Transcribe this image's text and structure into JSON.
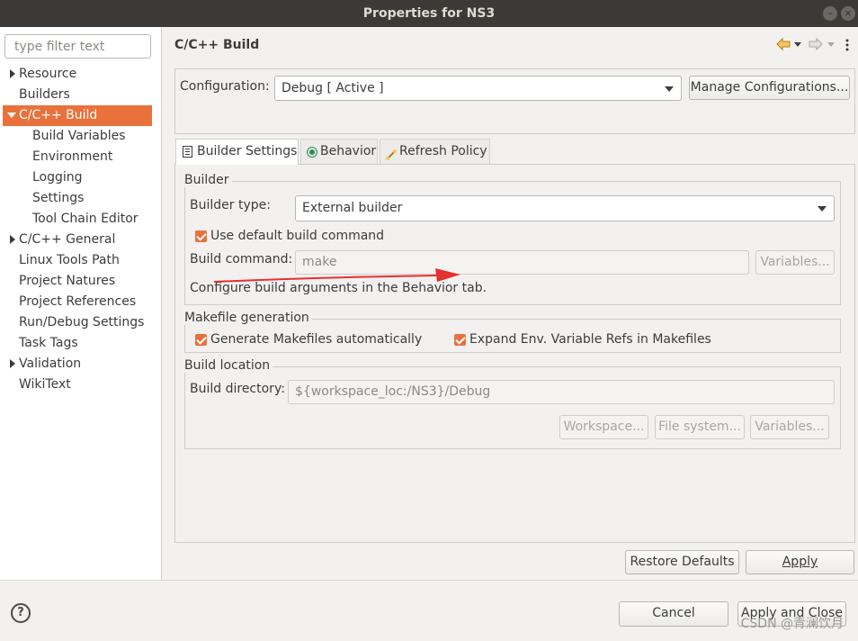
{
  "window": {
    "title": "Properties for NS3",
    "minimize_glyph": "–",
    "close_glyph": "×"
  },
  "sidebar": {
    "filter_placeholder": "type filter text",
    "items": [
      {
        "label": "Resource",
        "twisty": "collapsed"
      },
      {
        "label": "Builders"
      },
      {
        "label": "C/C++ Build",
        "twisty": "expanded",
        "selected": true
      },
      {
        "label": "Build Variables"
      },
      {
        "label": "Environment"
      },
      {
        "label": "Logging"
      },
      {
        "label": "Settings"
      },
      {
        "label": "Tool Chain Editor"
      },
      {
        "label": "C/C++ General",
        "twisty": "collapsed"
      },
      {
        "label": "Linux Tools Path"
      },
      {
        "label": "Project Natures"
      },
      {
        "label": "Project References"
      },
      {
        "label": "Run/Debug Settings"
      },
      {
        "label": "Task Tags"
      },
      {
        "label": "Validation",
        "twisty": "collapsed"
      },
      {
        "label": "WikiText"
      }
    ]
  },
  "header": {
    "title": "C/C++ Build",
    "back_icon": "back-arrow-icon",
    "forward_icon": "forward-arrow-icon",
    "menu_icon": "view-menu-icon"
  },
  "configuration": {
    "label": "Configuration:",
    "value": "Debug  [ Active ]",
    "manage_button": "Manage Configurations..."
  },
  "tabs": [
    {
      "label": "Builder Settings",
      "icon": "settings-sheet-icon",
      "active": true
    },
    {
      "label": "Behavior",
      "icon": "radio-icon"
    },
    {
      "label": "Refresh Policy",
      "icon": "refresh-policy-icon"
    }
  ],
  "builder": {
    "group_title": "Builder",
    "type_label": "Builder type:",
    "type_value": "External builder",
    "use_default_label": "Use default build command",
    "use_default_checked": true,
    "command_label": "Build command:",
    "command_value": "make",
    "variables_button": "Variables...",
    "hint": "Configure build arguments in the Behavior tab."
  },
  "makefile": {
    "group_title": "Makefile generation",
    "generate_label": "Generate Makefiles automatically",
    "generate_checked": true,
    "expand_label": "Expand Env. Variable Refs in Makefiles",
    "expand_checked": true
  },
  "location": {
    "group_title": "Build location",
    "directory_label": "Build directory:",
    "directory_value": "${workspace_loc:/NS3}/Debug",
    "workspace_button": "Workspace...",
    "filesystem_button": "File system...",
    "variables_button": "Variables..."
  },
  "actions": {
    "restore_defaults": "Restore Defaults",
    "apply": "Apply",
    "cancel": "Cancel",
    "apply_and_close": "Apply and Close"
  },
  "watermark": "CSDN @青澜饮月",
  "colors": {
    "accent": "#e9713c",
    "annotation_arrow": "#e53030"
  }
}
